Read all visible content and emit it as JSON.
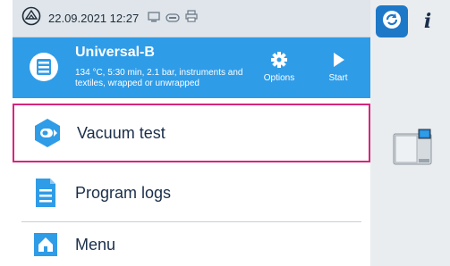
{
  "status_bar": {
    "datetime": "22.09.2021 12:27",
    "icons": [
      "device-logo-icon",
      "monitor-icon",
      "card-icon",
      "printer-icon"
    ]
  },
  "program": {
    "title": "Universal-B",
    "description": "134 °C, 5:30 min, 2.1 bar, instruments and textiles, wrapped or unwrapped",
    "options_label": "Options",
    "start_label": "Start",
    "icon": "program-drum-icon"
  },
  "menu": {
    "items": [
      {
        "label": "Vacuum test",
        "icon": "vacuum-test-icon",
        "selected": true
      },
      {
        "label": "Program logs",
        "icon": "document-icon",
        "selected": false
      },
      {
        "label": "Menu",
        "icon": "home-icon",
        "selected": false
      }
    ]
  },
  "side_panel": {
    "info_label": "i",
    "active_button_icon": "refresh-mode-icon",
    "device_icon": "sterilizer-device-icon"
  },
  "colors": {
    "accent_blue": "#2f9ce8",
    "dark_blue": "#1e78c8",
    "selection_pink": "#d6267d",
    "status_bar_bg": "#dfe5ea",
    "side_panel_bg": "#e9edf0"
  }
}
